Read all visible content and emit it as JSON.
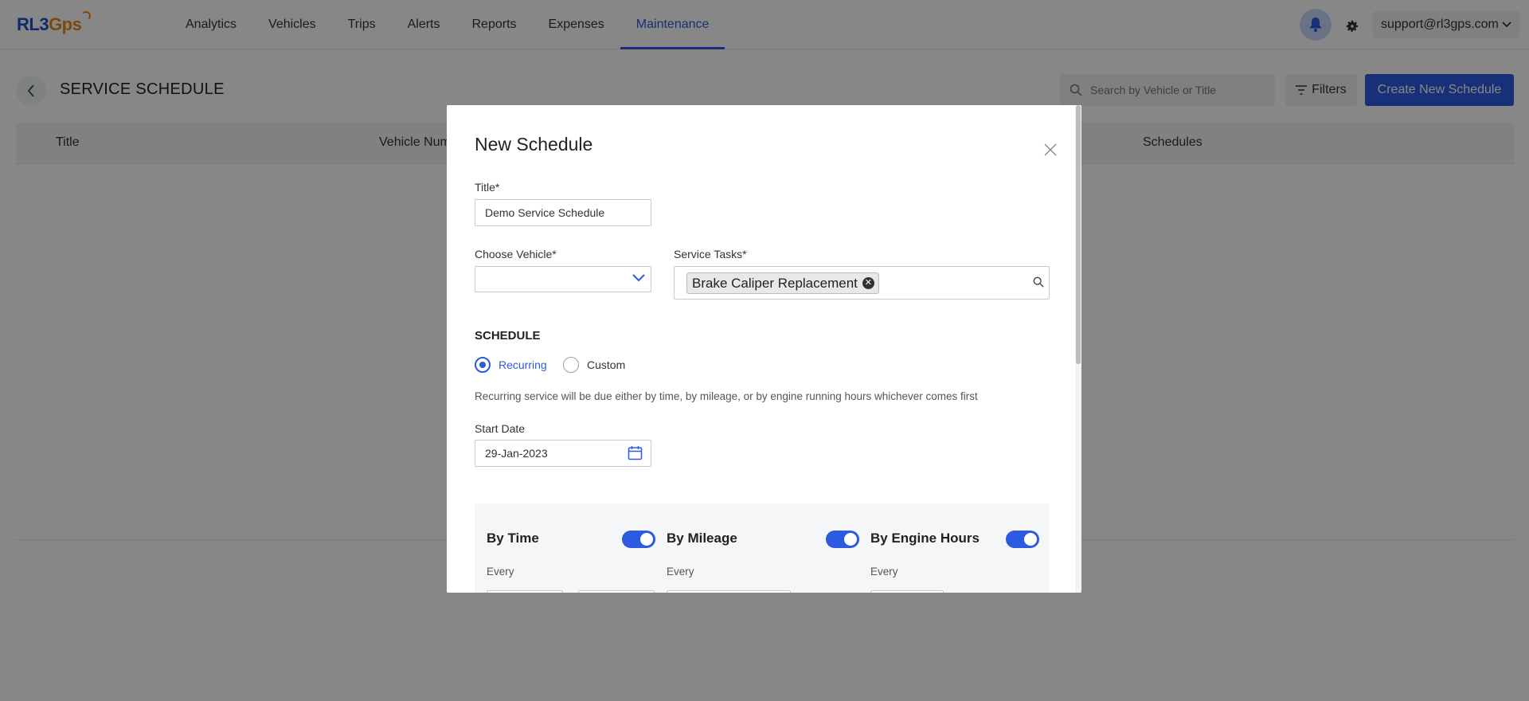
{
  "app": {
    "logo_main": "RL3",
    "logo_accent": "Gps"
  },
  "nav": {
    "items": [
      {
        "label": "Analytics"
      },
      {
        "label": "Vehicles"
      },
      {
        "label": "Trips"
      },
      {
        "label": "Alerts"
      },
      {
        "label": "Reports"
      },
      {
        "label": "Expenses"
      },
      {
        "label": "Maintenance",
        "active": true
      }
    ],
    "user_email": "support@rl3gps.com"
  },
  "page": {
    "title": "SERVICE SCHEDULE",
    "search_placeholder": "Search by Vehicle or Title",
    "filters_label": "Filters",
    "create_label": "Create New Schedule",
    "columns": [
      "Title",
      "Vehicle Num",
      "Schedules"
    ]
  },
  "modal": {
    "title": "New Schedule",
    "title_label": "Title*",
    "title_value": "Demo Service Schedule",
    "vehicle_label": "Choose Vehicle*",
    "vehicle_value": "",
    "tasks_label": "Service Tasks*",
    "tasks": [
      "Brake Caliper Replacement"
    ],
    "schedule_heading": "SCHEDULE",
    "schedule_options": [
      {
        "label": "Recurring",
        "checked": true
      },
      {
        "label": "Custom",
        "checked": false
      }
    ],
    "help_text": "Recurring service will be due either by time, by mileage, or by engine running hours whichever comes first",
    "start_date_label": "Start Date",
    "start_date_value": "29-Jan-2023",
    "rules": [
      {
        "title": "By Time",
        "enabled": true,
        "every_label": "Every"
      },
      {
        "title": "By Mileage",
        "enabled": true,
        "every_label": "Every"
      },
      {
        "title": "By Engine Hours",
        "enabled": true,
        "every_label": "Every"
      }
    ]
  },
  "colors": {
    "accent": "#2c5be0",
    "logo_orange": "#e8891a"
  }
}
